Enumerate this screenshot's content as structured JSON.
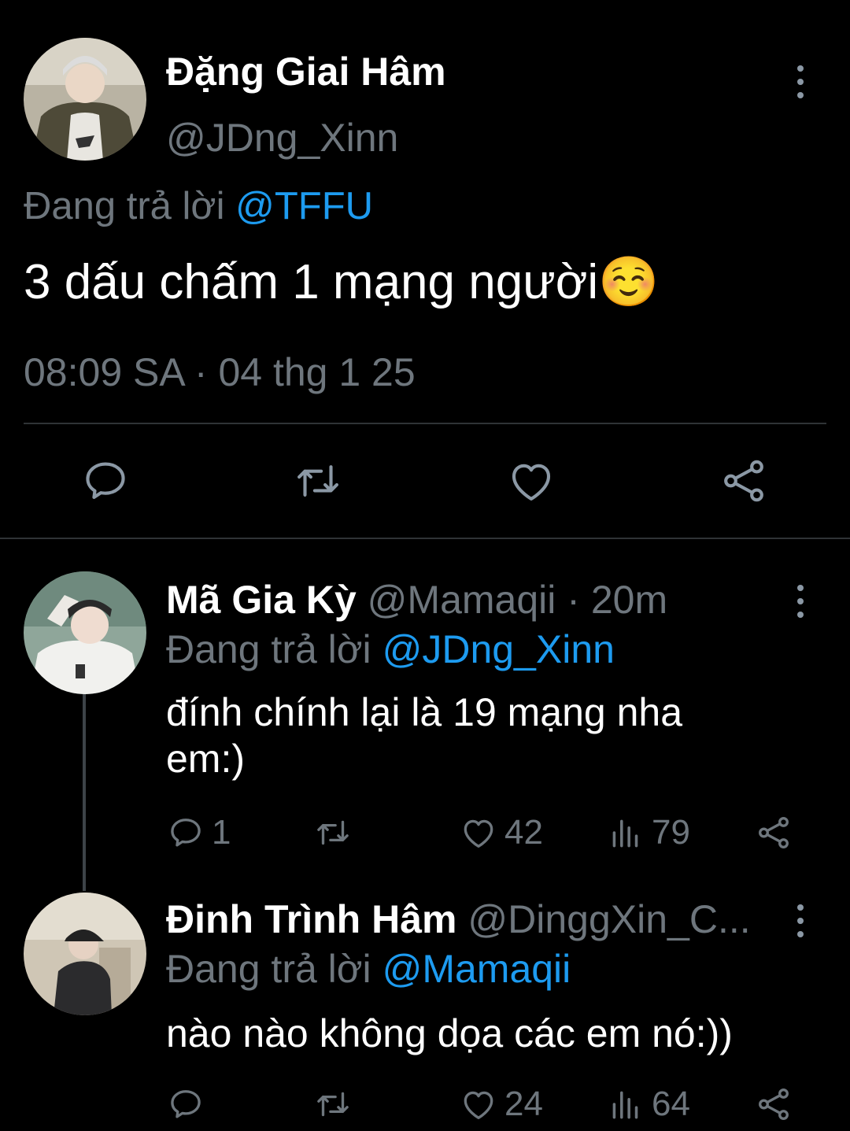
{
  "main_tweet": {
    "display_name": "Đặng Giai Hâm",
    "handle": "@JDng_Xinn",
    "reply_prefix": "Đang trả lời",
    "reply_to": "@TFFU",
    "text": "3 dấu chấm 1 mạng người",
    "emoji": "☺️",
    "time": "08:09 SA",
    "separator": "·",
    "date": "04 thg 1 25",
    "actions": [
      "reply-icon",
      "retweet-icon",
      "like-icon",
      "share-icon"
    ]
  },
  "replies": [
    {
      "display_name": "Mã Gia Kỳ",
      "handle": "@Mamaqii",
      "time_sep": "·",
      "time": "20m",
      "reply_prefix": "Đang trả lời",
      "reply_to": "@JDng_Xinn",
      "text_line1": "đính chính lại là 19 mạng nha",
      "text_line2": "em:)",
      "reply_count": "1",
      "retweet_count": "",
      "like_count": "42",
      "view_count": "79"
    },
    {
      "display_name": "Đinh Trình Hâm",
      "handle": "@DinggXin_C...",
      "reply_prefix": "Đang trả lời",
      "reply_to": "@Mamaqii",
      "text": "nào nào không dọa các em nó:))",
      "reply_count": "",
      "retweet_count": "",
      "like_count": "24",
      "view_count": "64"
    }
  ],
  "colors": {
    "background": "#000000",
    "text": "#e7e9ea",
    "muted": "#6e767d",
    "link": "#1d9bf0",
    "divider": "#2f3336"
  }
}
